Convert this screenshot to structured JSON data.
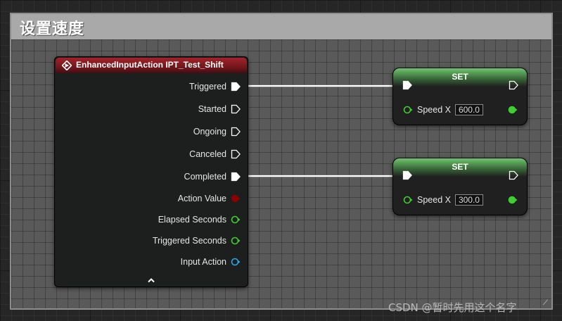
{
  "comment": {
    "title": "设置速度"
  },
  "event_node": {
    "title": "EnhancedInputAction IPT_Test_Shift",
    "header_color": "#8e1f25",
    "pins": [
      {
        "label": "Triggered",
        "type": "exec",
        "connected": true
      },
      {
        "label": "Started",
        "type": "exec",
        "connected": false
      },
      {
        "label": "Ongoing",
        "type": "exec",
        "connected": false
      },
      {
        "label": "Canceled",
        "type": "exec",
        "connected": false
      },
      {
        "label": "Completed",
        "type": "exec",
        "connected": true
      },
      {
        "label": "Action Value",
        "type": "bool",
        "color": "#8c0000"
      },
      {
        "label": "Elapsed Seconds",
        "type": "float",
        "color": "#3fcf2f"
      },
      {
        "label": "Triggered Seconds",
        "type": "float",
        "color": "#3fcf2f"
      },
      {
        "label": "Input Action",
        "type": "object",
        "color": "#2aa7e8"
      }
    ]
  },
  "set_nodes": [
    {
      "title": "SET",
      "var_label": "Speed X",
      "value": "600.0"
    },
    {
      "title": "SET",
      "var_label": "Speed X",
      "value": "300.0"
    }
  ],
  "colors": {
    "float_pin": "#3fcf2f",
    "set_header": "#5cb85c",
    "wire": "#ffffff"
  },
  "watermark": "CSDN @暂时先用这个名字"
}
